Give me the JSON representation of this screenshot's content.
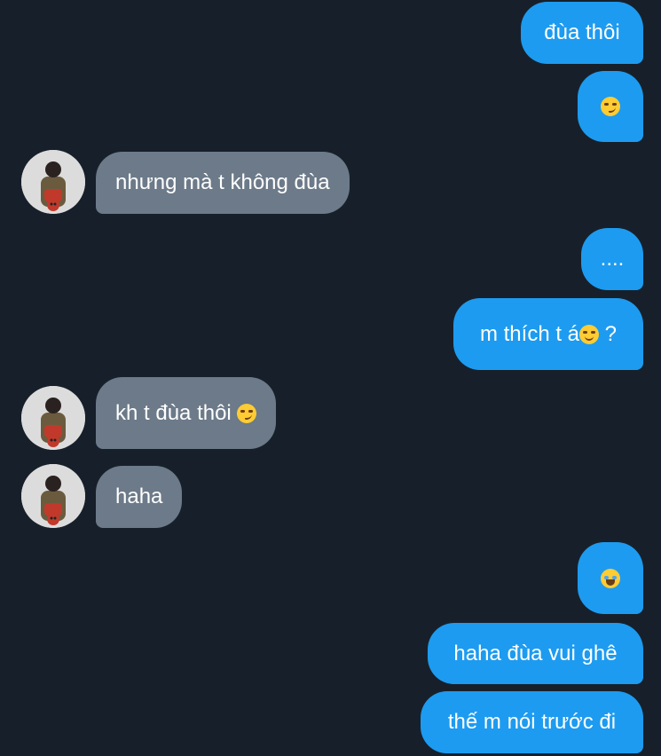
{
  "messages": [
    {
      "side": "sent",
      "text": "đùa thôi"
    },
    {
      "side": "sent",
      "emoji": "smirk-emoji"
    },
    {
      "side": "received",
      "text": "nhưng mà t không đùa",
      "avatar": "user-avatar"
    },
    {
      "side": "sent",
      "text": "...."
    },
    {
      "side": "sent",
      "text": "m thích t á",
      "emoji": "slightly-smiling-emoji",
      "text_after": " ?"
    },
    {
      "side": "received",
      "text": "kh t đùa thôi ",
      "emoji": "smirk-emoji",
      "avatar": "user-avatar"
    },
    {
      "side": "received",
      "text": "haha",
      "avatar": "user-avatar"
    },
    {
      "side": "sent",
      "emoji": "laughing-tears-emoji"
    },
    {
      "side": "sent",
      "text": "haha đùa vui ghê"
    },
    {
      "side": "sent",
      "text": "thế m nói trước đi"
    }
  ],
  "colors": {
    "background": "#17202a",
    "sent_bubble": "#1d9bf0",
    "received_bubble": "#6c7a89",
    "text": "#ffffff"
  }
}
